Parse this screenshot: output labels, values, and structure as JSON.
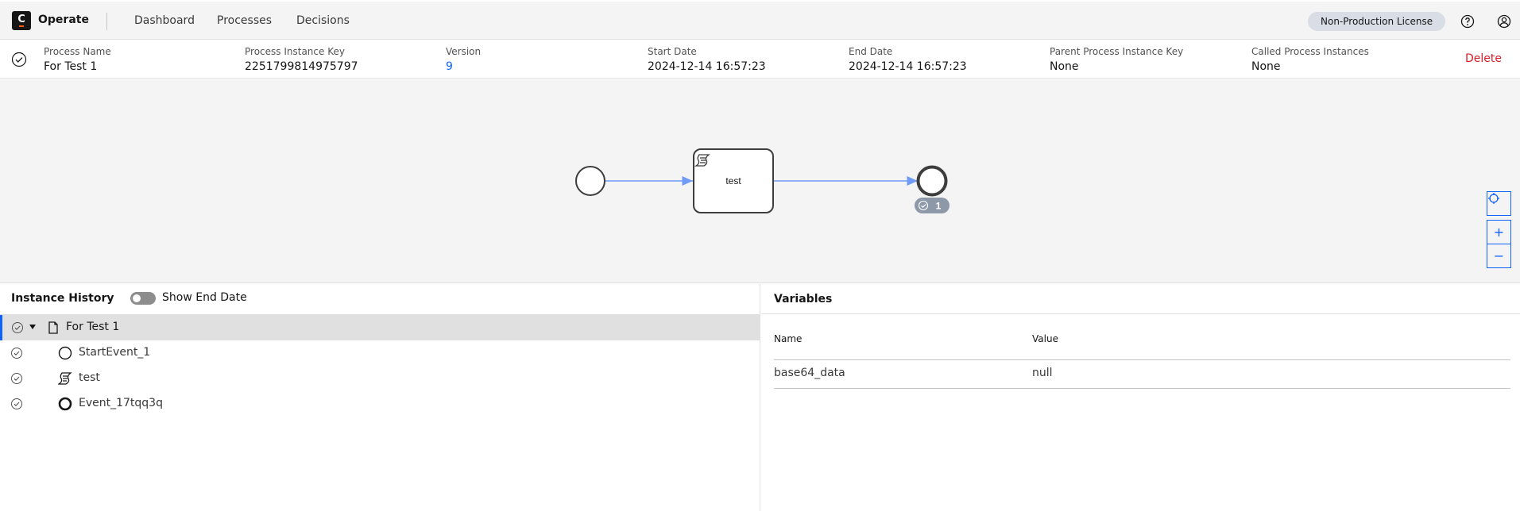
{
  "header": {
    "logo_letter": "C",
    "app_name": "Operate",
    "nav": [
      "Dashboard",
      "Processes",
      "Decisions"
    ],
    "license": "Non-Production License"
  },
  "instance": {
    "columns": [
      {
        "label": "Process Name",
        "value": "For Test 1"
      },
      {
        "label": "Process Instance Key",
        "value": "2251799814975797"
      },
      {
        "label": "Version",
        "value": "9"
      },
      {
        "label": "Start Date",
        "value": "2024-12-14 16:57:23"
      },
      {
        "label": "End Date",
        "value": "2024-12-14 16:57:23"
      },
      {
        "label": "Parent Process Instance Key",
        "value": "None"
      },
      {
        "label": "Called Process Instances",
        "value": "None"
      }
    ],
    "delete_label": "Delete"
  },
  "diagram": {
    "task_label": "test",
    "end_badge_count": "1",
    "zoom_in": "+",
    "zoom_out": "−"
  },
  "history": {
    "title": "Instance History",
    "toggle_label": "Show End Date",
    "rows": [
      {
        "label": "For Test 1",
        "icon": "document-icon"
      },
      {
        "label": "StartEvent_1",
        "icon": "start-event-icon"
      },
      {
        "label": "test",
        "icon": "script-task-icon"
      },
      {
        "label": "Event_17tqq3q",
        "icon": "end-event-icon"
      }
    ]
  },
  "variables": {
    "title": "Variables",
    "col_name": "Name",
    "col_value": "Value",
    "rows": [
      {
        "name": "base64_data",
        "value": "null"
      }
    ]
  },
  "colors": {
    "accent": "#0f62fe",
    "danger": "#da1e28",
    "flow": "#6f9af5",
    "badge": "#8d99a8"
  }
}
